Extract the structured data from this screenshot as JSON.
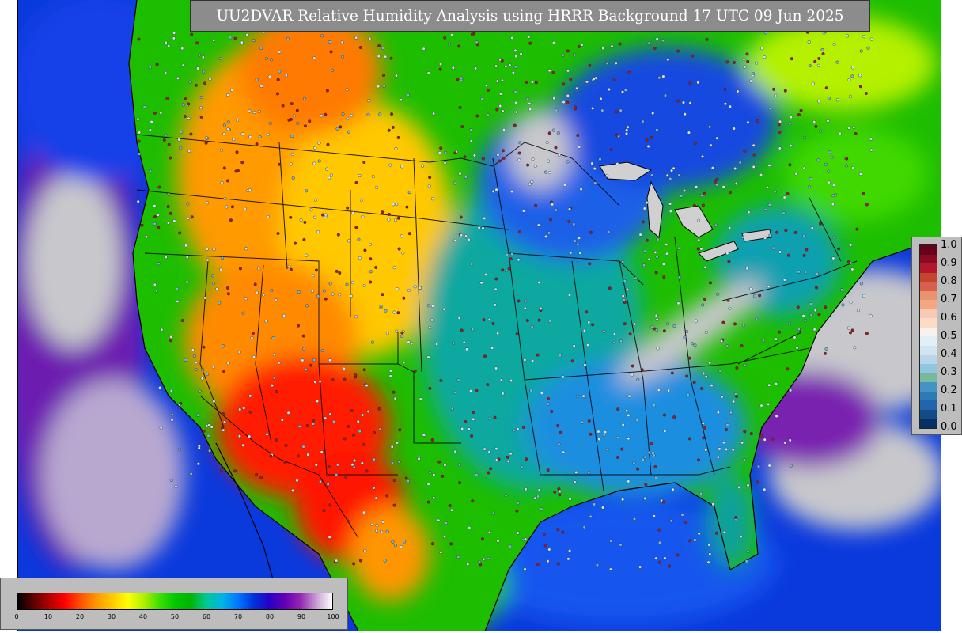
{
  "title": "UU2DVAR Relative Humidity Analysis using HRRR Background 17 UTC 09 Jun 2025",
  "obs_legend": {
    "labels": [
      "1.0",
      "0.9",
      "0.8",
      "0.7",
      "0.6",
      "0.5",
      "0.4",
      "0.3",
      "0.2",
      "0.1",
      "0.0"
    ],
    "colors": [
      "#67001f",
      "#8b0a22",
      "#b2182b",
      "#c4442e",
      "#d6604d",
      "#e8936e",
      "#f4a582",
      "#f9c9b1",
      "#fddbc7",
      "#f7f2ee",
      "#e3eef5",
      "#d1e5f0",
      "#b8d6e8",
      "#92c5de",
      "#78b89e",
      "#4393c3",
      "#2f79b5",
      "#2166ac",
      "#134b84",
      "#053061"
    ]
  },
  "rh_legend": {
    "ticks": [
      "0",
      "10",
      "20",
      "30",
      "40",
      "50",
      "60",
      "70",
      "80",
      "90",
      "100"
    ],
    "gradient": [
      "#000000",
      "#5a0000",
      "#b00000",
      "#ff0000",
      "#ff5000",
      "#ff9600",
      "#ffc800",
      "#ffff00",
      "#b4f000",
      "#40e000",
      "#00c800",
      "#00b400",
      "#00c896",
      "#00b4e6",
      "#0078ff",
      "#0032dc",
      "#2800c8",
      "#6400b4",
      "#9628b4",
      "#c8a0d2",
      "#ffffff"
    ]
  },
  "map_colors": {
    "ocean_pacific": "#0a2fd8",
    "ocean_atlantic": "#1f55e6",
    "gulf": "#1c5df0",
    "dry_red": "#ff1500",
    "orange": "#ff9a00",
    "yellow": "#f5e600",
    "green": "#1fc400",
    "teal": "#00a6b4",
    "blue": "#0a80e8",
    "purple": "#7a22b0",
    "gray_cloud": "#c8c8cc",
    "lake": "#d2d2d2"
  }
}
